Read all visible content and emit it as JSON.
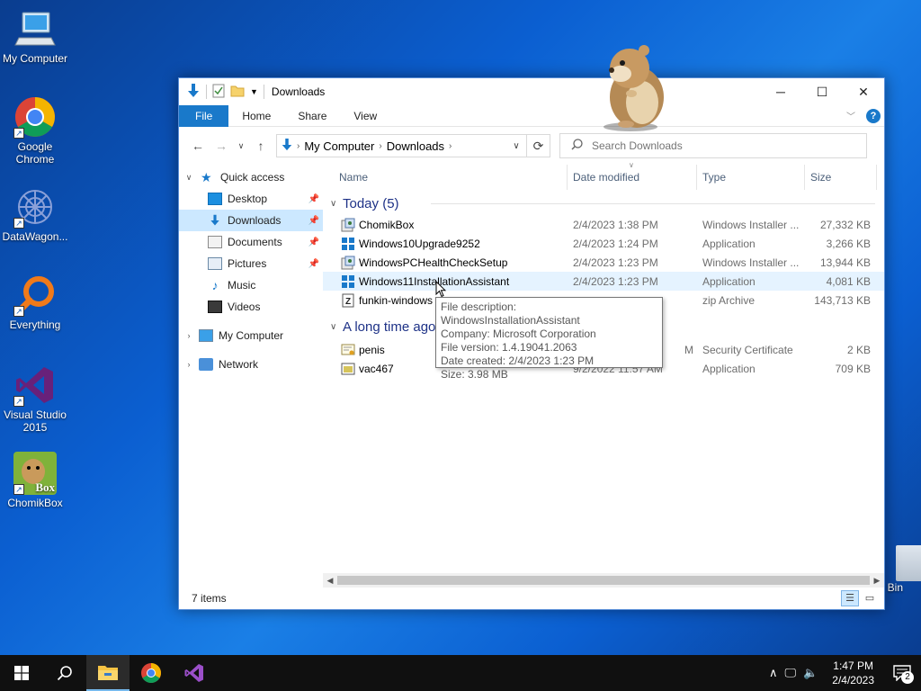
{
  "desktop": {
    "icons": [
      {
        "label": "My Computer",
        "icon": "computer-icon"
      },
      {
        "label": "Google Chrome",
        "icon": "chrome-icon"
      },
      {
        "label": "DataWagon...",
        "icon": "datawagon-icon"
      },
      {
        "label": "Everything",
        "icon": "everything-search-icon"
      },
      {
        "label": "Visual Studio 2015",
        "icon": "visual-studio-icon"
      },
      {
        "label": "ChomikBox",
        "icon": "chomikbox-icon"
      }
    ],
    "chomikbox_logo_text": "Box",
    "recycle_bin_label": "e Bin"
  },
  "window": {
    "title": "Downloads",
    "ribbon": {
      "file": "File",
      "home": "Home",
      "share": "Share",
      "view": "View"
    },
    "help_label": "?",
    "address": {
      "root": "My Computer",
      "folder": "Downloads"
    },
    "search": {
      "placeholder": "Search Downloads"
    },
    "nav_pane": {
      "quick_access": "Quick access",
      "items": [
        "Desktop",
        "Downloads",
        "Documents",
        "Pictures",
        "Music",
        "Videos"
      ],
      "my_computer": "My Computer",
      "network": "Network"
    },
    "columns": {
      "name": "Name",
      "date": "Date modified",
      "type": "Type",
      "size": "Size"
    },
    "groups": {
      "today": "Today (5)",
      "long_ago": "A long time ago"
    },
    "files_today": [
      {
        "name": "ChomikBox",
        "date": "2/4/2023 1:38 PM",
        "type": "Windows Installer ...",
        "size": "27,332 KB"
      },
      {
        "name": "Windows10Upgrade9252",
        "date": "2/4/2023 1:24 PM",
        "type": "Application",
        "size": "3,266 KB"
      },
      {
        "name": "WindowsPCHealthCheckSetup",
        "date": "2/4/2023 1:23 PM",
        "type": "Windows Installer ...",
        "size": "13,944 KB"
      },
      {
        "name": "Windows11InstallationAssistant",
        "date": "2/4/2023 1:23 PM",
        "type": "Application",
        "size": "4,081 KB"
      },
      {
        "name": "funkin-windows",
        "date": "",
        "type": "zip Archive",
        "size": "143,713 KB"
      }
    ],
    "files_old": [
      {
        "name": "penis",
        "date": "M",
        "type": "Security Certificate",
        "size": "2 KB"
      },
      {
        "name": "vac467",
        "date": "9/2/2022 11:57 AM",
        "type": "Application",
        "size": "709 KB"
      }
    ],
    "tooltip": {
      "line1": "File description: WindowsInstallationAssistant",
      "line2": "Company: Microsoft Corporation",
      "line3": "File version: 1.4.19041.2063",
      "line4": "Date created: 2/4/2023 1:23 PM",
      "line5": "Size: 3.98 MB"
    },
    "status": {
      "items": "7 items"
    }
  },
  "taskbar": {
    "time": "1:47 PM",
    "date": "2/4/2023",
    "notifications": "2"
  },
  "colors": {
    "accent": "#1979ca",
    "selection": "#cce8ff",
    "group_title": "#1e3287"
  }
}
